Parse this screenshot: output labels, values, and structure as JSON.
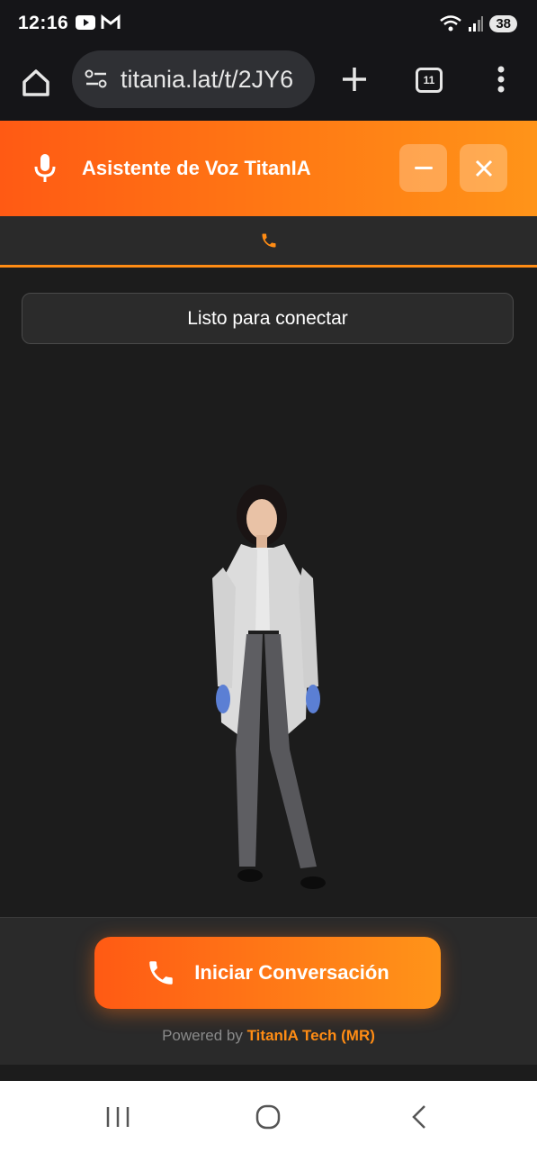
{
  "status_bar": {
    "time": "12:16",
    "battery": "38",
    "left_icons": [
      "youtube-icon",
      "gmail-icon"
    ],
    "right_icons": [
      "wifi-icon",
      "signal-icon"
    ]
  },
  "browser": {
    "url": "titania.lat/t/2JY6",
    "tab_count": "11"
  },
  "header": {
    "title": "Asistente de Voz TitanIA"
  },
  "main": {
    "status_text": "Listo para conectar"
  },
  "footer": {
    "start_button": "Iniciar Conversación",
    "powered_prefix": "Powered by",
    "powered_brand": "TitanIA Tech (MR)"
  },
  "colors": {
    "accent": "#ff7a14",
    "accent_start": "#ff5a14",
    "accent_end": "#ff9419",
    "background": "#1c1c1c",
    "panel": "#2a2a2a"
  }
}
